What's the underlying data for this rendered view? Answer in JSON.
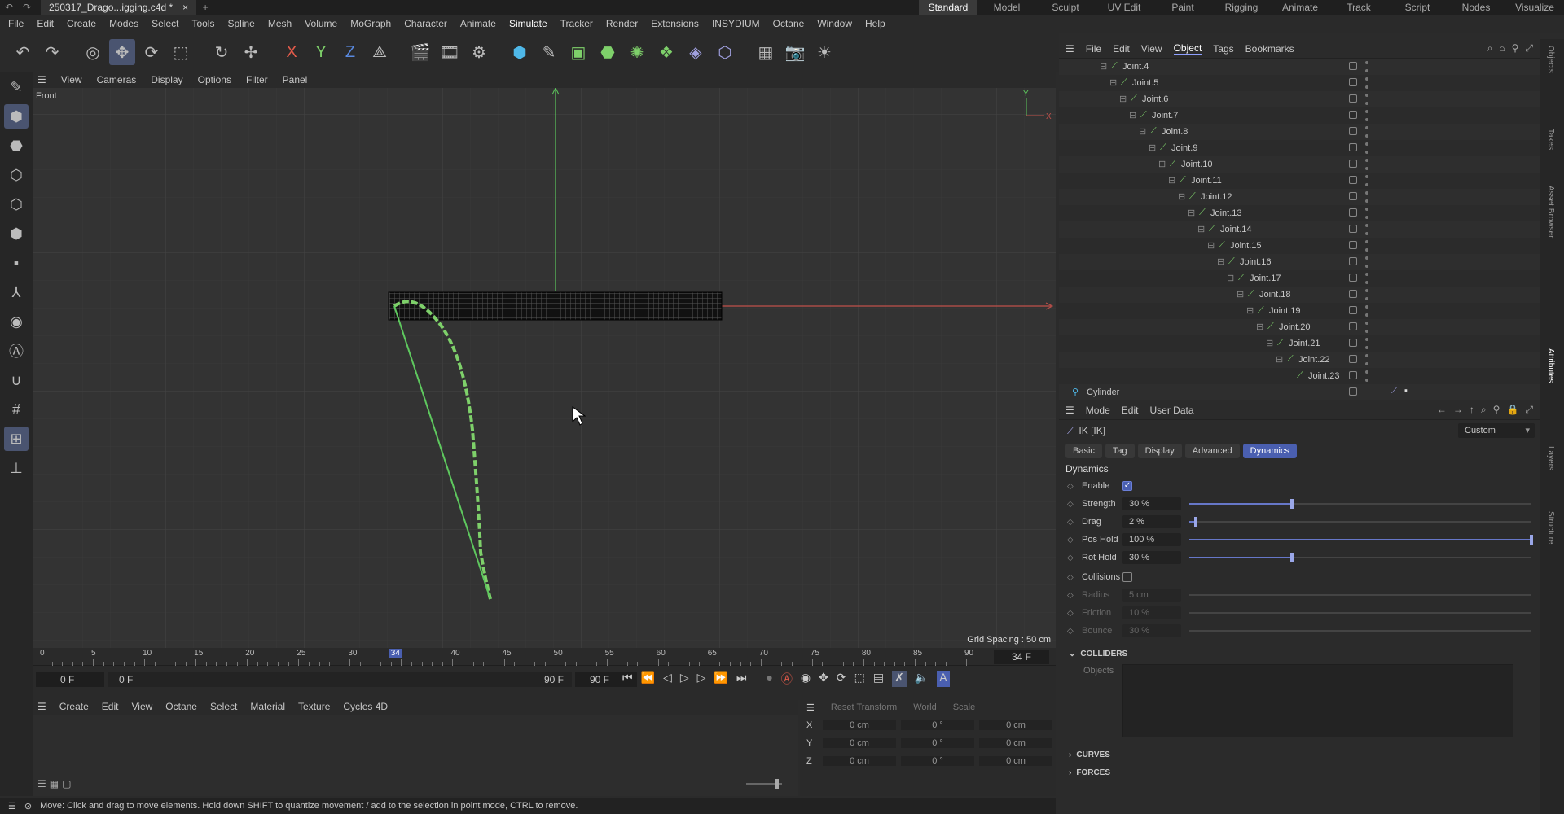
{
  "titlebar": {
    "doc_tab": "250317_Drago...igging.c4d *",
    "close": "×",
    "add": "+",
    "layouts": [
      "Standard",
      "Model",
      "Sculpt",
      "UV Edit",
      "Paint",
      "Rigging",
      "Animate",
      "Track",
      "Script",
      "Nodes",
      "Visualize"
    ],
    "active_layout": "Standard"
  },
  "menubar": [
    "File",
    "Edit",
    "Create",
    "Modes",
    "Select",
    "Tools",
    "Spline",
    "Mesh",
    "Volume",
    "MoGraph",
    "Character",
    "Animate",
    "Simulate",
    "Tracker",
    "Render",
    "Extensions",
    "INSYDIUM",
    "Octane",
    "Window",
    "Help"
  ],
  "toolbar": {
    "axis_x": "X",
    "axis_y": "Y",
    "axis_z": "Z"
  },
  "viewport": {
    "menu": [
      "View",
      "Cameras",
      "Display",
      "Options",
      "Filter",
      "Panel"
    ],
    "view_name": "Front",
    "grid_spacing": "Grid Spacing : 50 cm",
    "axis_y_label": "Y",
    "axis_x_label": "X"
  },
  "timeline": {
    "ticks": [
      "0",
      "5",
      "10",
      "15",
      "20",
      "25",
      "30",
      "34",
      "40",
      "45",
      "50",
      "55",
      "60",
      "65",
      "70",
      "75",
      "80",
      "85",
      "90"
    ],
    "current_frame": "34 F",
    "start_a": "0 F",
    "start_b": "0 F",
    "end_a": "90 F",
    "end_b": "90 F"
  },
  "material_bar": [
    "Create",
    "Edit",
    "View",
    "Octane",
    "Select",
    "Material",
    "Texture",
    "Cycles 4D"
  ],
  "coords": {
    "reset_transform": "Reset Transform",
    "space": "World",
    "mode": "Scale",
    "rows": [
      {
        "axis": "X",
        "pos": "0 cm",
        "rot": "0 °",
        "scale": "0 cm"
      },
      {
        "axis": "Y",
        "pos": "0 cm",
        "rot": "0 °",
        "scale": "0 cm"
      },
      {
        "axis": "Z",
        "pos": "0 cm",
        "rot": "0 °",
        "scale": "0 cm"
      }
    ]
  },
  "statusbar": {
    "text": "Move: Click and drag to move elements. Hold down SHIFT to quantize movement / add to the selection in point mode, CTRL to remove."
  },
  "object_manager": {
    "menu": [
      "File",
      "Edit",
      "View",
      "Object",
      "Tags",
      "Bookmarks"
    ],
    "active_menu": "Object",
    "joints": [
      "Joint.4",
      "Joint.5",
      "Joint.6",
      "Joint.7",
      "Joint.8",
      "Joint.9",
      "Joint.10",
      "Joint.11",
      "Joint.12",
      "Joint.13",
      "Joint.14",
      "Joint.15",
      "Joint.16",
      "Joint.17",
      "Joint.18",
      "Joint.19",
      "Joint.20",
      "Joint.21",
      "Joint.22",
      "Joint.23"
    ],
    "cylinder": "Cylinder"
  },
  "attributes": {
    "menu": [
      "Mode",
      "Edit",
      "User Data"
    ],
    "object_title": "IK [IK]",
    "preset": "Custom",
    "tabs": [
      "Basic",
      "Tag",
      "Display",
      "Advanced",
      "Dynamics"
    ],
    "active_tab": "Dynamics",
    "section_title": "Dynamics",
    "enable_label": "Enable",
    "params": [
      {
        "label": "Strength",
        "value": "30 %",
        "level": 0.3
      },
      {
        "label": "Drag",
        "value": "2 %",
        "level": 0.02
      },
      {
        "label": "Pos Hold",
        "value": "100 %",
        "level": 1.0
      },
      {
        "label": "Rot Hold",
        "value": "30 %",
        "level": 0.3
      }
    ],
    "collisions_label": "Collisions",
    "dim_params": [
      {
        "label": "Radius",
        "value": "5 cm",
        "level": 0
      },
      {
        "label": "Friction",
        "value": "10 %",
        "level": 0.1
      },
      {
        "label": "Bounce",
        "value": "30 %",
        "level": 0.3
      }
    ],
    "colliders_title": "COLLIDERS",
    "objects_label": "Objects",
    "curves_title": "CURVES",
    "forces_title": "FORCES"
  },
  "right_sidebar": [
    "Objects",
    "Takes",
    "Asset Browser",
    "Attributes",
    "Layers",
    "Structure"
  ]
}
